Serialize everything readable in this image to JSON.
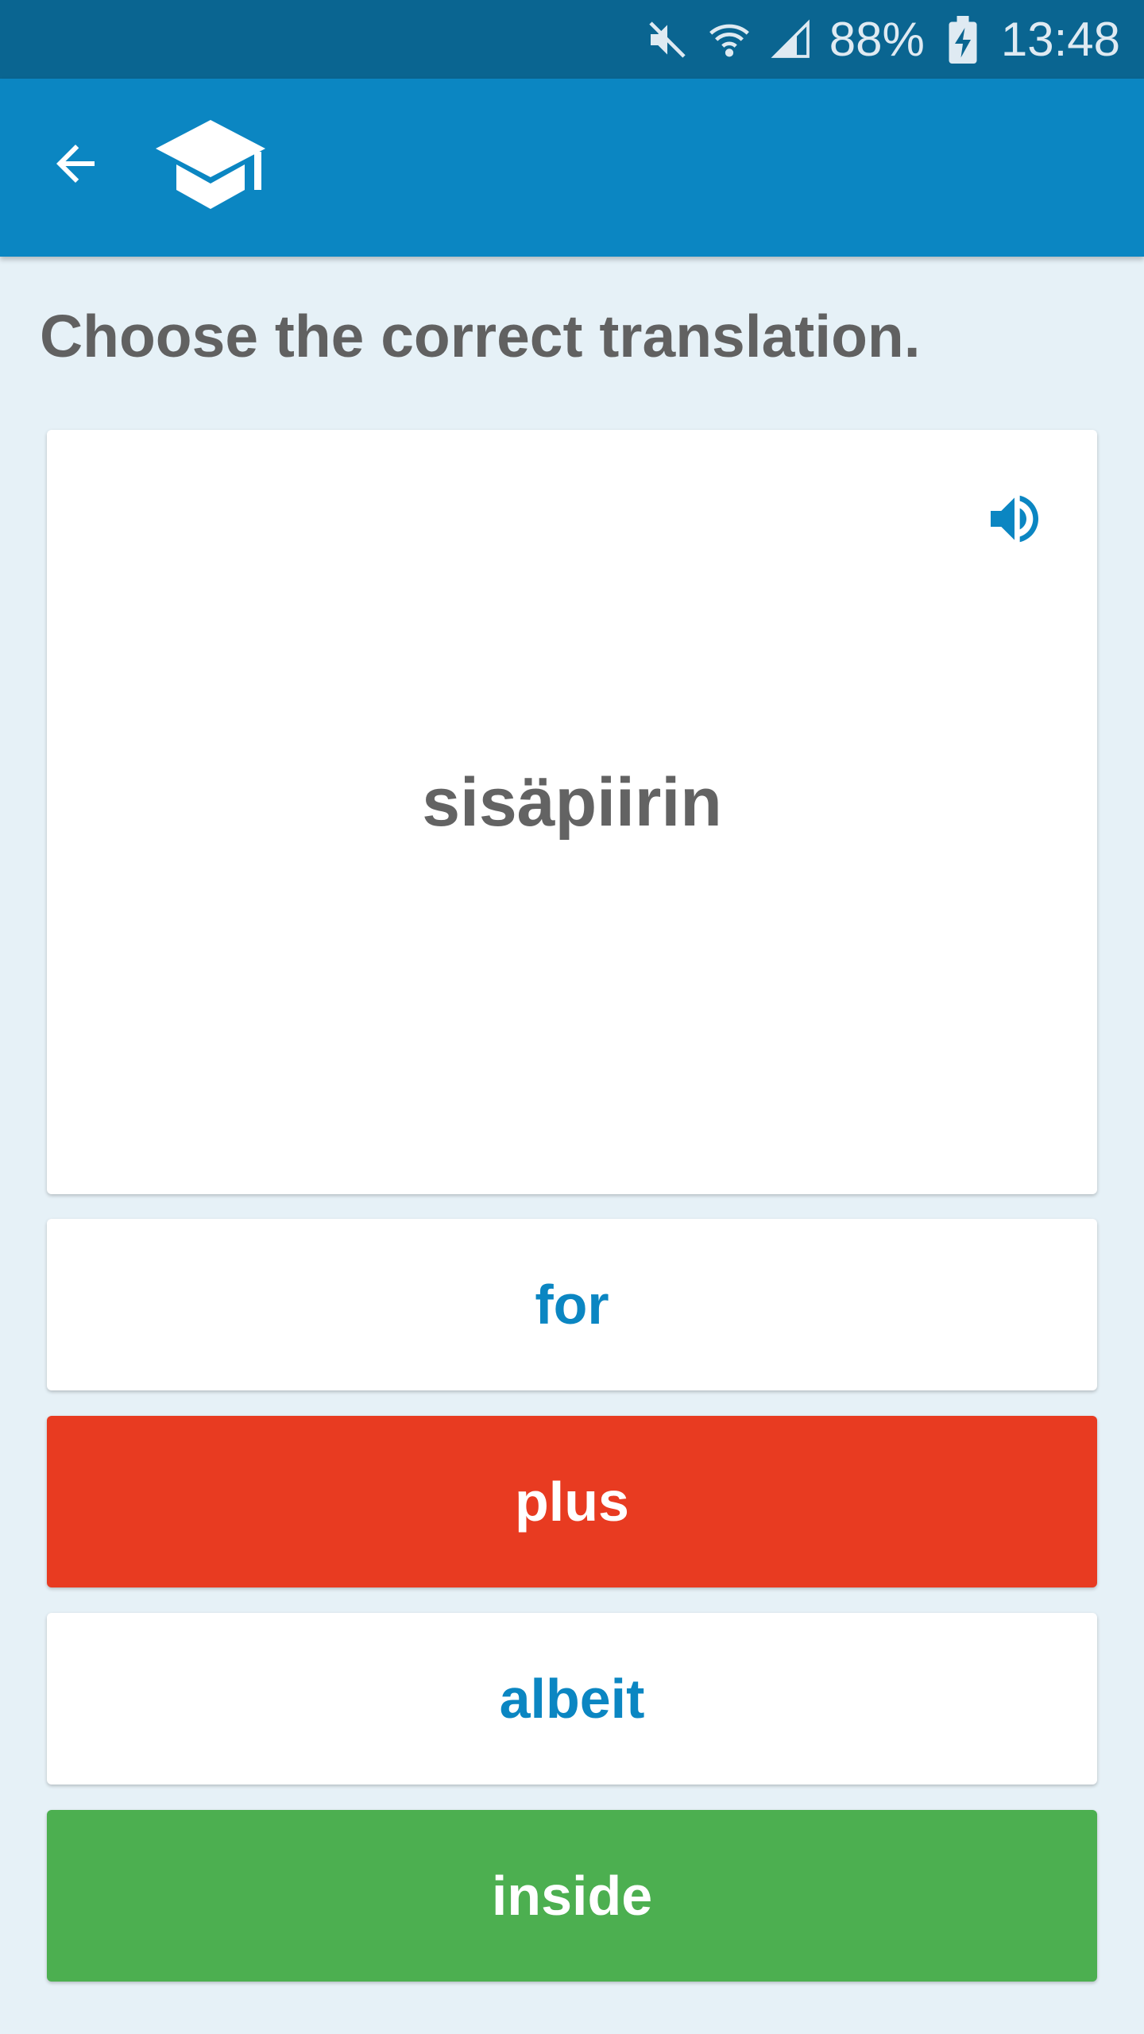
{
  "status": {
    "battery": "88%",
    "time": "13:48",
    "icons": [
      "mute-icon",
      "wifi-icon",
      "signal-icon",
      "battery-charging-icon"
    ]
  },
  "toolbar": {
    "back_icon": "arrow-left-icon",
    "app_icon": "graduation-cap-icon",
    "color": "#0b86c2"
  },
  "quiz": {
    "instruction": "Choose the correct translation.",
    "word": "sisäpiirin",
    "speaker_icon": "speaker-icon",
    "answers": [
      {
        "label": "for",
        "state": "neutral"
      },
      {
        "label": "plus",
        "state": "wrong"
      },
      {
        "label": "albeit",
        "state": "neutral"
      },
      {
        "label": "inside",
        "state": "correct"
      }
    ]
  },
  "colors": {
    "wrong": "#e83b21",
    "correct": "#4caf50",
    "accent": "#0b86c2"
  }
}
